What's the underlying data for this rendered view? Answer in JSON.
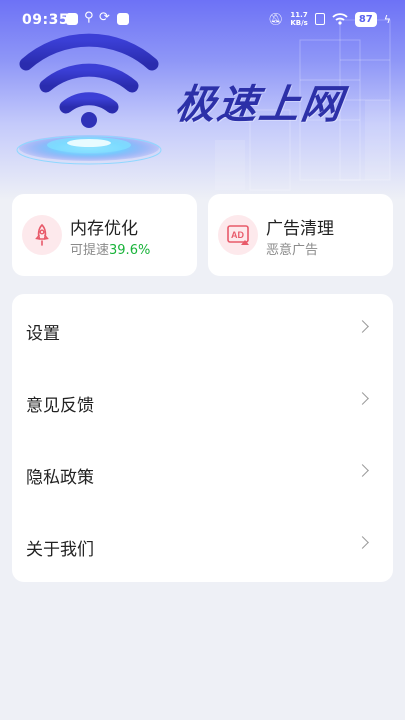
{
  "status_bar": {
    "time": "09:35",
    "net_speed_value": "11.7",
    "net_speed_unit": "KB/s",
    "battery": "87",
    "icons": [
      "app-notification-icon",
      "usb-icon",
      "sync-icon",
      "mail-icon",
      "mute-bell-icon",
      "sim-icon",
      "wifi-icon",
      "charging-icon"
    ]
  },
  "hero": {
    "title": "极速上网",
    "logo_icon": "wifi-logo-icon"
  },
  "features": [
    {
      "title": "内存优化",
      "subtitle_prefix": "可提速",
      "subtitle_value": "39.6%",
      "icon": "rocket-icon"
    },
    {
      "title": "广告清理",
      "subtitle": "恶意广告",
      "icon": "ad-block-icon"
    }
  ],
  "menu": {
    "items": [
      {
        "label": "设置"
      },
      {
        "label": "意见反馈"
      },
      {
        "label": "隐私政策"
      },
      {
        "label": "关于我们"
      }
    ]
  },
  "colors": {
    "accent": "#5a62ef",
    "highlight_green": "#19b33a",
    "icon_red": "#e85a6a",
    "icon_bg": "#fde9ec"
  }
}
